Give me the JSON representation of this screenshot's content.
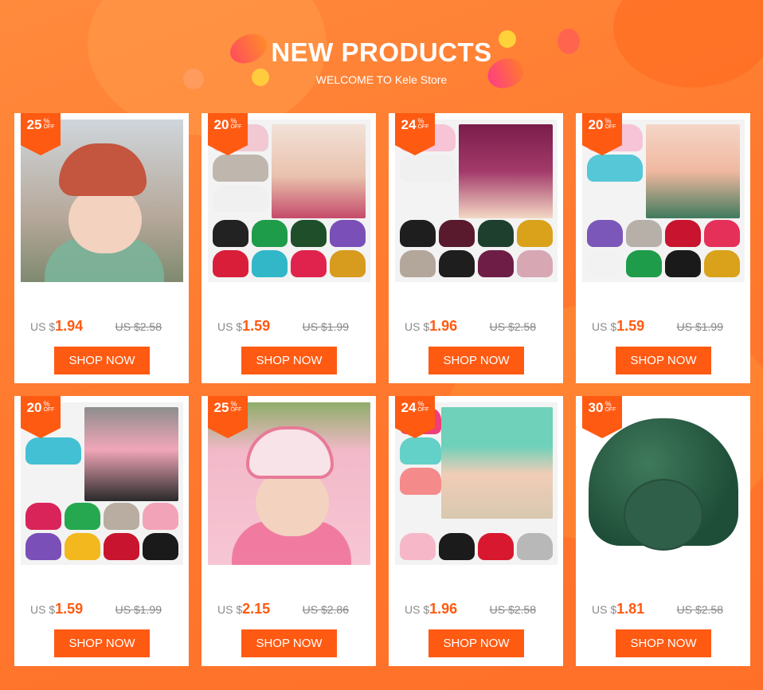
{
  "header": {
    "title": "NEW PRODUCTS",
    "subtitle": "WELCOME TO Kele Store"
  },
  "accent_color": "#ff5a12",
  "products": [
    {
      "discount": "25",
      "pct": "%",
      "off": "OFF",
      "currency": "US $",
      "price": "1.94",
      "old_price": "US $2.58",
      "button": "SHOP NOW"
    },
    {
      "discount": "20",
      "pct": "%",
      "off": "OFF",
      "currency": "US $",
      "price": "1.59",
      "old_price": "US $1.99",
      "button": "SHOP NOW"
    },
    {
      "discount": "24",
      "pct": "%",
      "off": "OFF",
      "currency": "US $",
      "price": "1.96",
      "old_price": "US $2.58",
      "button": "SHOP NOW"
    },
    {
      "discount": "20",
      "pct": "%",
      "off": "OFF",
      "currency": "US $",
      "price": "1.59",
      "old_price": "US $1.99",
      "button": "SHOP NOW"
    },
    {
      "discount": "20",
      "pct": "%",
      "off": "OFF",
      "currency": "US $",
      "price": "1.59",
      "old_price": "US $1.99",
      "button": "SHOP NOW"
    },
    {
      "discount": "25",
      "pct": "%",
      "off": "OFF",
      "currency": "US $",
      "price": "2.15",
      "old_price": "US $2.86",
      "button": "SHOP NOW"
    },
    {
      "discount": "24",
      "pct": "%",
      "off": "OFF",
      "currency": "US $",
      "price": "1.96",
      "old_price": "US $2.58",
      "button": "SHOP NOW"
    },
    {
      "discount": "30",
      "pct": "%",
      "off": "OFF",
      "currency": "US $",
      "price": "1.81",
      "old_price": "US $2.58",
      "button": "SHOP NOW"
    }
  ]
}
